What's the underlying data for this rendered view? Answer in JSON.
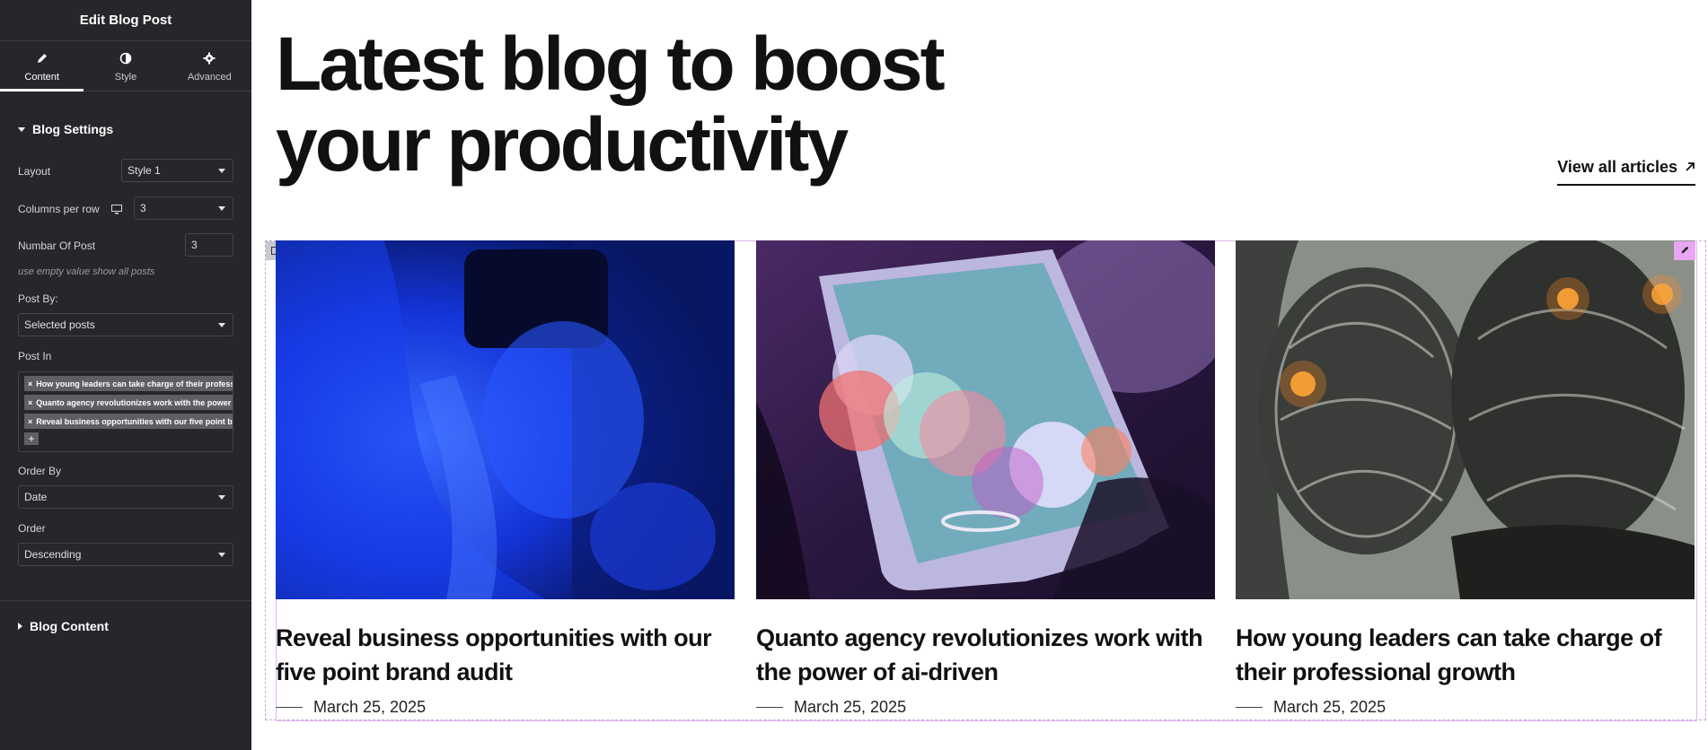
{
  "panel": {
    "title": "Edit Blog Post",
    "tabs": [
      {
        "label": "Content",
        "icon": "pencil-icon"
      },
      {
        "label": "Style",
        "icon": "half-circle-icon"
      },
      {
        "label": "Advanced",
        "icon": "gear-icon"
      }
    ],
    "blog_settings": {
      "heading": "Blog Settings",
      "layout_label": "Layout",
      "layout_value": "Style 1",
      "columns_label": "Columns per row",
      "columns_value": "3",
      "num_posts_label": "Numbar Of Post",
      "num_posts_value": "3",
      "num_posts_hint": "use empty value show all posts",
      "post_by_label": "Post By:",
      "post_by_value": "Selected posts",
      "post_in_label": "Post In",
      "post_in_tags": [
        "How young leaders can take charge of their professional growth",
        "Quanto agency revolutionizes work with the power of ai-driven",
        "Reveal business opportunities with our five point brand audit"
      ],
      "order_by_label": "Order By",
      "order_by_value": "Date",
      "order_label": "Order",
      "order_value": "Descending"
    },
    "blog_content_heading": "Blog Content"
  },
  "canvas": {
    "headline_line1": "Latest blog to boost",
    "headline_line2": "your productivity",
    "view_all": "View all articles",
    "posts": [
      {
        "title": "Reveal business opportunities with our five point brand audit",
        "date": "March 25, 2025"
      },
      {
        "title": "Quanto agency revolutionizes work with the power of ai-driven",
        "date": "March 25, 2025"
      },
      {
        "title": "How young leaders can take charge of their professional growth",
        "date": "March 25, 2025"
      }
    ]
  },
  "colors": {
    "panel_bg": "#26272b",
    "accent_pink": "#e9a6f5",
    "text_dark": "#111111"
  }
}
